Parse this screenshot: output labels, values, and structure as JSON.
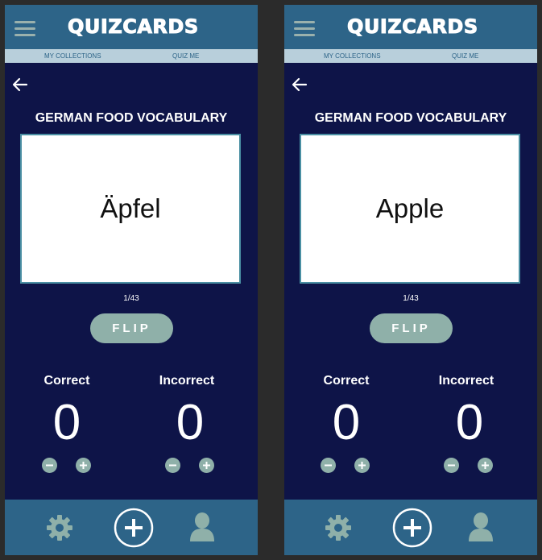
{
  "frames": [
    {
      "app_name": "QUIZCARDS",
      "nav": {
        "collections_label": "MY COLLECTIONS",
        "quiz_label": "QUIZ ME"
      },
      "deck_title": "GERMAN FOOD VOCABULARY",
      "card_word": "Äpfel",
      "counter": "1/43",
      "flip_label": "FLIP",
      "correct_label": "Correct",
      "incorrect_label": "Incorrect",
      "correct_count": "0",
      "incorrect_count": "0"
    },
    {
      "app_name": "QUIZCARDS",
      "nav": {
        "collections_label": "MY COLLECTIONS",
        "quiz_label": "QUIZ ME"
      },
      "deck_title": "GERMAN FOOD VOCABULARY",
      "card_word": "Apple",
      "counter": "1/43",
      "flip_label": "FLIP",
      "correct_label": "Correct",
      "incorrect_label": "Incorrect",
      "correct_count": "0",
      "incorrect_count": "0"
    }
  ],
  "icons": {
    "menu": "hamburger-menu-icon",
    "back": "back-arrow-icon",
    "minus": "minus-icon",
    "plus": "plus-icon",
    "settings": "gear-icon",
    "add": "add-circle-icon",
    "profile": "user-icon"
  },
  "colors": {
    "background": "#0e1448",
    "bar": "#2d6488",
    "nav": "#b8cfdb",
    "accent": "#8fb0a9",
    "card_border": "#4a8fa3"
  }
}
